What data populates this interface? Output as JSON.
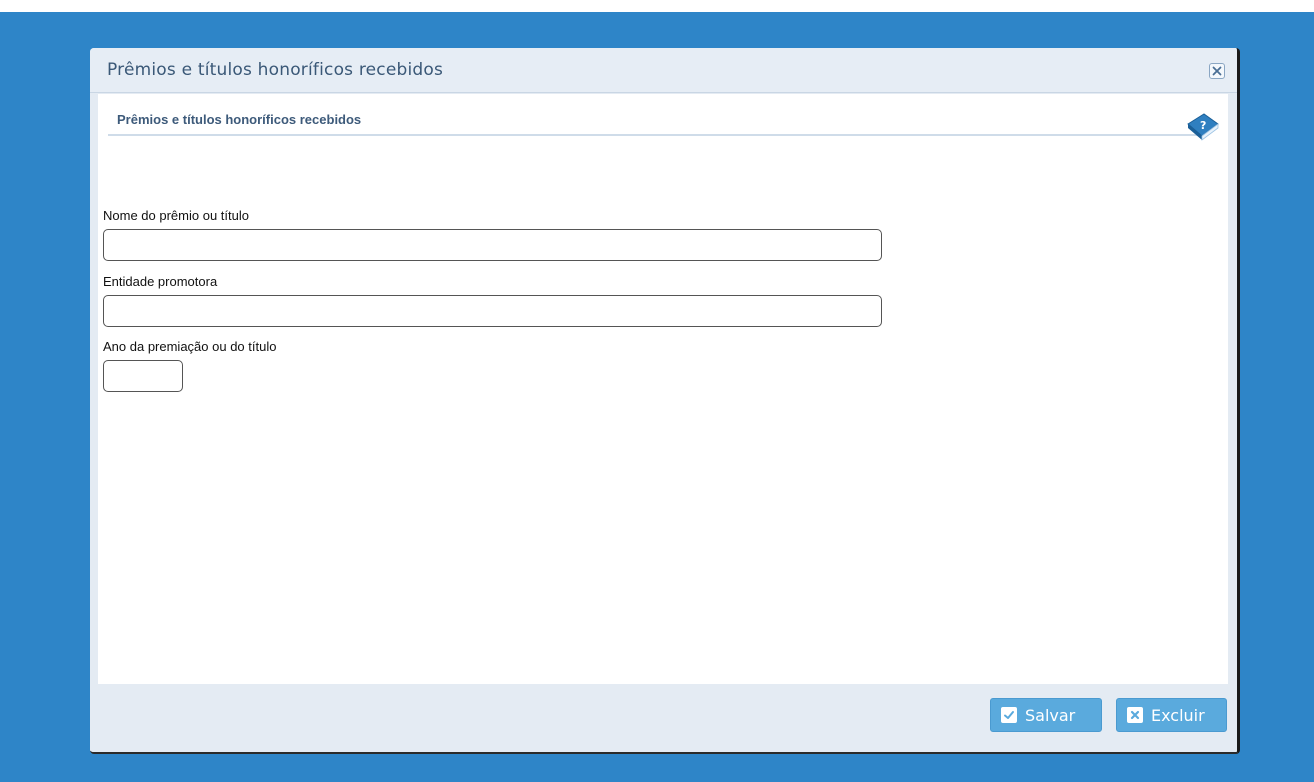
{
  "dialog": {
    "title": "Prêmios e títulos honoríficos recebidos",
    "close_icon": "close-icon"
  },
  "section": {
    "title": "Prêmios e títulos honoríficos recebidos",
    "help_icon": "help-book-icon"
  },
  "form": {
    "nome": {
      "label": "Nome do prêmio ou título",
      "value": ""
    },
    "entidade": {
      "label": "Entidade promotora",
      "value": ""
    },
    "ano": {
      "label": "Ano da premiação ou do título",
      "value": ""
    }
  },
  "footer": {
    "save_label": "Salvar",
    "save_icon": "check-icon",
    "delete_label": "Excluir",
    "delete_icon": "x-icon"
  },
  "colors": {
    "background": "#2e85c8",
    "button": "#5aaadd",
    "title_text": "#3a5877"
  }
}
